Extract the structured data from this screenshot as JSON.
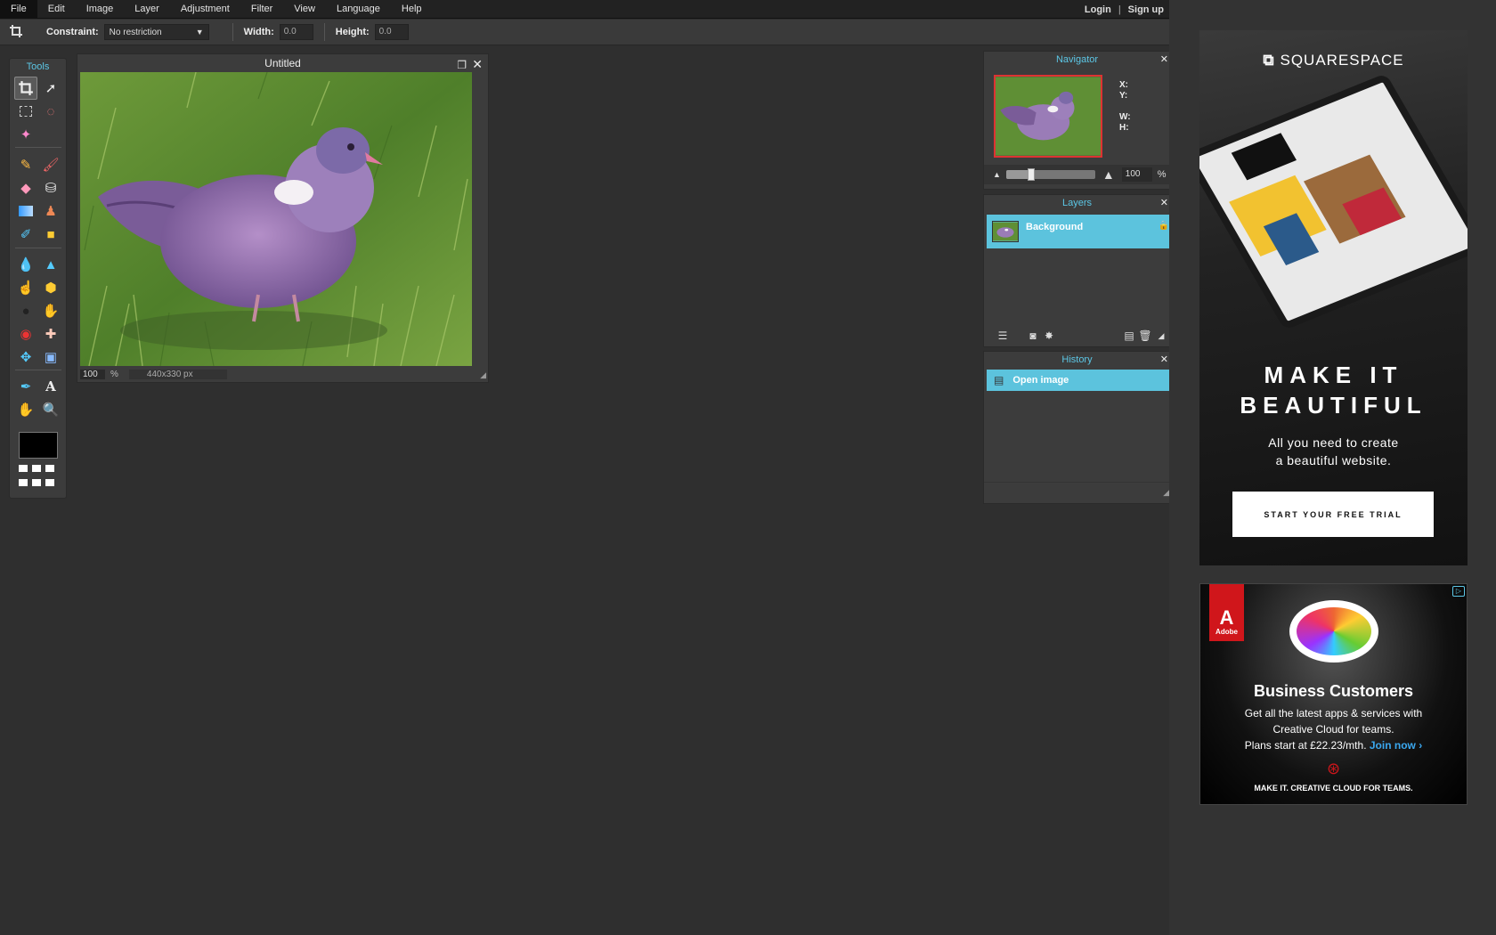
{
  "menubar": {
    "items": [
      "File",
      "Edit",
      "Image",
      "Layer",
      "Adjustment",
      "Filter",
      "View",
      "Language",
      "Help"
    ],
    "login": "Login",
    "separator": "|",
    "signup": "Sign up"
  },
  "options": {
    "constraint_label": "Constraint:",
    "constraint_value": "No restriction",
    "width_label": "Width:",
    "width_value": "0.0",
    "height_label": "Height:",
    "height_value": "0.0"
  },
  "tools": {
    "title": "Tools",
    "foreground_color": "#000000"
  },
  "document": {
    "title": "Untitled",
    "zoom": "100",
    "zoom_unit": "%",
    "dimensions": "440x330 px"
  },
  "navigator": {
    "title": "Navigator",
    "x_label": "X:",
    "y_label": "Y:",
    "w_label": "W:",
    "h_label": "H:",
    "zoom": "100",
    "zoom_unit": "%",
    "zoom_slider_level": 0.28
  },
  "layers": {
    "title": "Layers",
    "items": [
      {
        "name": "Background",
        "locked": true
      }
    ]
  },
  "history": {
    "title": "History",
    "items": [
      {
        "label": "Open image"
      }
    ]
  },
  "ads": {
    "squarespace": {
      "brand": "SQUARESPACE",
      "headline": "MAKE IT\nBEAUTIFUL",
      "subtext": "All you need to create\na beautiful website.",
      "cta": "START YOUR FREE TRIAL"
    },
    "adobe": {
      "logo_text": "Adobe",
      "title": "Business Customers",
      "line1": "Get all the latest apps & services with",
      "line2": "Creative Cloud for teams.",
      "line3": "Plans start at £22.23/mth.",
      "join": "Join now ›",
      "tagline": "MAKE IT.  CREATIVE CLOUD FOR TEAMS."
    }
  },
  "colors": {
    "accent": "#5cc7e6",
    "selection": "#5cc3dd",
    "background": "#2f2f2f"
  }
}
